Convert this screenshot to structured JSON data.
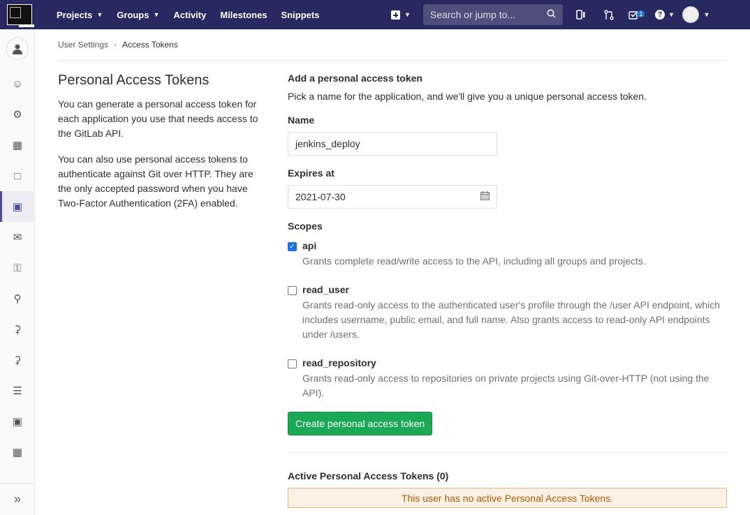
{
  "navbar": {
    "items": [
      {
        "label": "Projects",
        "dropdown": true
      },
      {
        "label": "Groups",
        "dropdown": true
      },
      {
        "label": "Activity",
        "dropdown": false
      },
      {
        "label": "Milestones",
        "dropdown": false
      },
      {
        "label": "Snippets",
        "dropdown": false
      }
    ],
    "search_placeholder": "Search or jump to...",
    "todo_count": "1",
    "bg_color": "#292961"
  },
  "sidebar": {
    "items": [
      {
        "icon": "profile-icon"
      },
      {
        "icon": "account-icon"
      },
      {
        "icon": "applications-icon"
      },
      {
        "icon": "chat-icon"
      },
      {
        "icon": "access-tokens-icon",
        "active": true
      },
      {
        "icon": "emails-icon"
      },
      {
        "icon": "password-icon"
      },
      {
        "icon": "notifications-icon"
      },
      {
        "icon": "ssh-keys-icon"
      },
      {
        "icon": "gpg-keys-icon"
      },
      {
        "icon": "preferences-icon"
      },
      {
        "icon": "active-sessions-icon"
      },
      {
        "icon": "authentication-log-icon"
      }
    ]
  },
  "breadcrumb": {
    "parent": "User Settings",
    "current": "Access Tokens"
  },
  "left": {
    "title": "Personal Access Tokens",
    "desc1": "You can generate a personal access token for each application you use that needs access to the GitLab API.",
    "desc2": "You can also use personal access tokens to authenticate against Git over HTTP. They are the only accepted password when you have Two-Factor Authentication (2FA) enabled."
  },
  "form": {
    "section_title": "Add a personal access token",
    "help": "Pick a name for the application, and we'll give you a unique personal access token.",
    "name_label": "Name",
    "name_value": "jenkins_deploy",
    "expires_label": "Expires at",
    "expires_value": "2021-07-30",
    "scopes_label": "Scopes",
    "scopes": [
      {
        "name": "api",
        "checked": true,
        "desc": "Grants complete read/write access to the API, including all groups and projects."
      },
      {
        "name": "read_user",
        "checked": false,
        "desc": "Grants read-only access to the authenticated user's profile through the /user API endpoint, which includes username, public email, and full name. Also grants access to read-only API endpoints under /users."
      },
      {
        "name": "read_repository",
        "checked": false,
        "desc": "Grants read-only access to repositories on private projects using Git-over-HTTP (not using the API)."
      }
    ],
    "submit_label": "Create personal access token",
    "submit_color": "#1aaa55"
  },
  "active_tokens": {
    "title": "Active Personal Access Tokens (0)",
    "empty_message": "This user has no active Personal Access Tokens."
  }
}
